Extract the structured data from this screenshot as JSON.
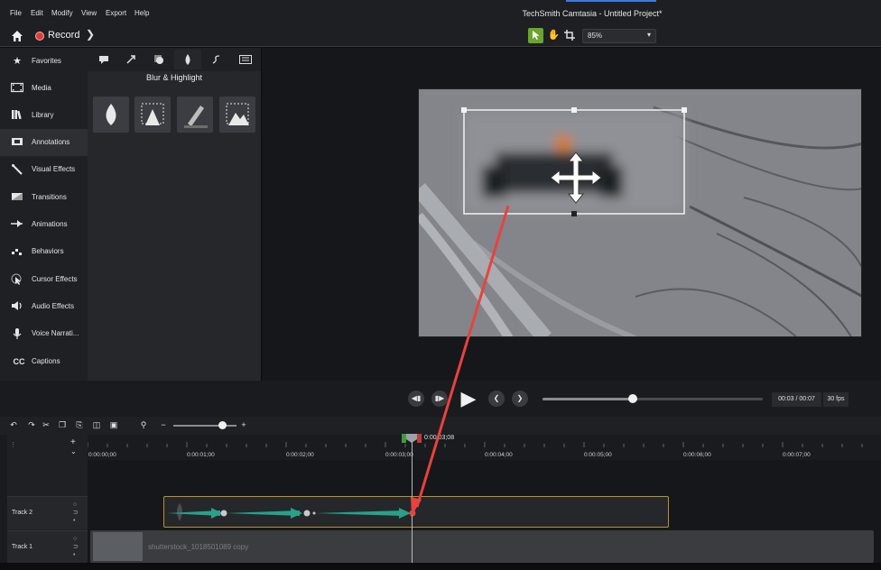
{
  "menu": [
    "File",
    "Edit",
    "Modify",
    "View",
    "Export",
    "Help"
  ],
  "app_title": "TechSmith Camtasia - Untitled Project*",
  "toolbar": {
    "record_label": "Record",
    "zoom": "85%"
  },
  "sidebar": {
    "items": [
      {
        "label": "Favorites",
        "icon": "star-icon"
      },
      {
        "label": "Media",
        "icon": "film-icon"
      },
      {
        "label": "Library",
        "icon": "library-icon"
      },
      {
        "label": "Annotations",
        "icon": "annotation-icon"
      },
      {
        "label": "Visual Effects",
        "icon": "wand-icon"
      },
      {
        "label": "Transitions",
        "icon": "transition-icon"
      },
      {
        "label": "Animations",
        "icon": "animation-icon"
      },
      {
        "label": "Behaviors",
        "icon": "behavior-icon"
      },
      {
        "label": "Cursor Effects",
        "icon": "cursor-icon"
      },
      {
        "label": "Audio Effects",
        "icon": "audio-icon"
      },
      {
        "label": "Voice Narrati...",
        "icon": "mic-icon"
      },
      {
        "label": "Captions",
        "icon": "cc-icon"
      }
    ],
    "cc_text": "CC",
    "active": "Annotations"
  },
  "panel": {
    "heading": "Blur & Highlight"
  },
  "playback": {
    "time": "00:03 / 00:07",
    "fps": "30 fps",
    "progress": 0.43
  },
  "timeline": {
    "playhead_time": "0:00:03;08",
    "ticks": [
      "0:00:00;00",
      "0:00:01;00",
      "0:00:02;00",
      "0:00:03;00",
      "0:00:04;00",
      "0:00:05;00",
      "0:00:06;00",
      "0:00:07;00"
    ],
    "tracks": [
      {
        "name": "Track 2"
      },
      {
        "name": "Track 1",
        "clip_label": "shutterstock_1018501089 copy"
      }
    ]
  },
  "colors": {
    "accent_green": "#6aa52d",
    "record_red": "#e23a3a",
    "clip_border": "#b7932a",
    "annotation_arrow": "#e8423f",
    "keyframe_teal": "#2aa08a"
  }
}
